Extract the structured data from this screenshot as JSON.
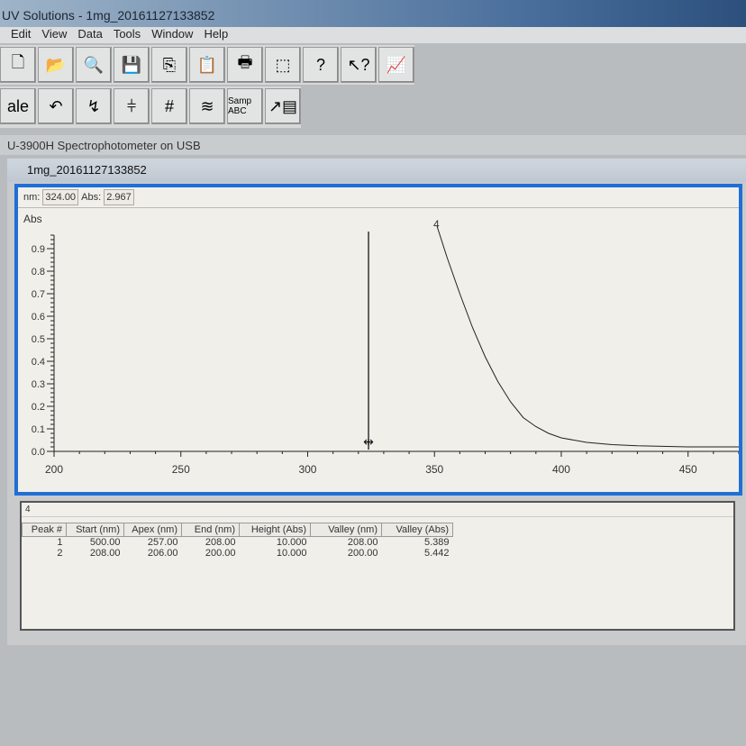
{
  "app": {
    "title": "UV Solutions - 1mg_20161127133852"
  },
  "menu": [
    "Edit",
    "View",
    "Data",
    "Tools",
    "Window",
    "Help"
  ],
  "toolbar1": [
    {
      "icon": "new-icon",
      "glyph": "🗋"
    },
    {
      "icon": "open-folder-icon",
      "glyph": "📂"
    },
    {
      "icon": "search-file-icon",
      "glyph": "🔍"
    },
    {
      "icon": "save-icon",
      "glyph": "💾"
    },
    {
      "icon": "copy-icon",
      "glyph": "⎘"
    },
    {
      "icon": "paste-icon",
      "glyph": "📋"
    },
    {
      "icon": "print-icon",
      "glyph": "🖶"
    },
    {
      "icon": "instrument-icon",
      "glyph": "⬚"
    },
    {
      "icon": "help-icon",
      "glyph": "?"
    },
    {
      "icon": "context-help-icon",
      "glyph": "↖?"
    },
    {
      "icon": "spectrum-window-icon",
      "glyph": "📈"
    }
  ],
  "toolbar2": [
    {
      "icon": "scale-icon",
      "glyph": "ale"
    },
    {
      "icon": "undo-zoom-icon",
      "glyph": "↶"
    },
    {
      "icon": "trace-icon",
      "glyph": "↯"
    },
    {
      "icon": "cursor-icon",
      "glyph": "⫩"
    },
    {
      "icon": "grid-icon",
      "glyph": "#"
    },
    {
      "icon": "overlay-icon",
      "glyph": "≋"
    },
    {
      "icon": "sample-label-icon",
      "glyph": "Samp ABC"
    },
    {
      "icon": "data-transfer-icon",
      "glyph": "↗▤"
    }
  ],
  "instrument": "U-3900H Spectrophotometer on USB",
  "document": {
    "title": "1mg_20161127133852"
  },
  "readout": {
    "nm_label": "nm:",
    "nm": "324.00",
    "abs_label": "Abs:",
    "abs": "2.967"
  },
  "chart_data": {
    "type": "line",
    "ylabel": "Abs",
    "xlabel": "",
    "xlim": [
      200,
      470
    ],
    "ylim": [
      0,
      1.0
    ],
    "xticks": [
      "200",
      "250",
      "300",
      "350",
      "400",
      "450"
    ],
    "yticks": [
      "0.0",
      "0.1",
      "0.2",
      "0.3",
      "0.4",
      "0.5",
      "0.6",
      "0.7",
      "0.8",
      "0.9"
    ],
    "peak_label": "4",
    "cursor_nm": 324,
    "series": [
      {
        "name": "1mg",
        "x": [
          351,
          355,
          360,
          365,
          370,
          375,
          380,
          385,
          390,
          395,
          400,
          410,
          420,
          430,
          450,
          470
        ],
        "y": [
          1.0,
          0.86,
          0.7,
          0.55,
          0.42,
          0.31,
          0.22,
          0.15,
          0.11,
          0.08,
          0.06,
          0.04,
          0.03,
          0.025,
          0.02,
          0.02
        ]
      }
    ]
  },
  "peak_table": {
    "title": "4",
    "headers": [
      "Peak #",
      "Start (nm)",
      "Apex (nm)",
      "End (nm)",
      "Height (Abs)",
      "Valley (nm)",
      "Valley (Abs)"
    ],
    "rows": [
      [
        "1",
        "500.00",
        "257.00",
        "208.00",
        "10.000",
        "208.00",
        "5.389"
      ],
      [
        "2",
        "208.00",
        "206.00",
        "200.00",
        "10.000",
        "200.00",
        "5.442"
      ]
    ]
  }
}
